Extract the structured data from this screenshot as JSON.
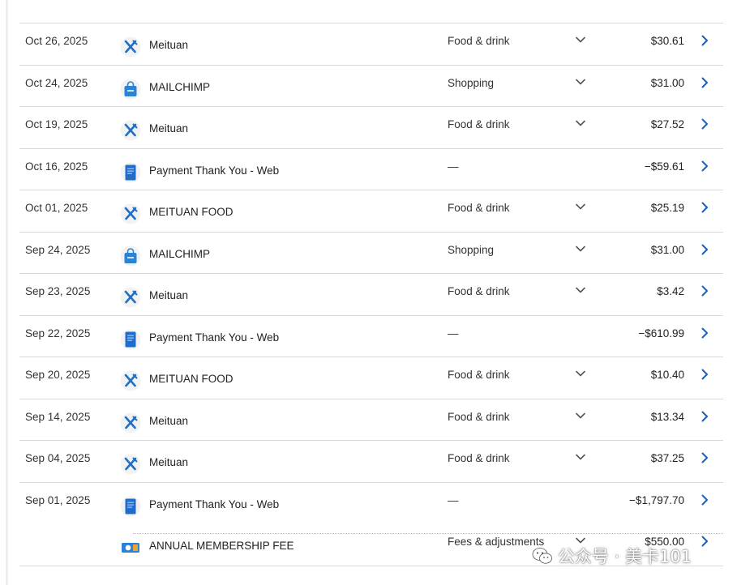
{
  "transactions": [
    {
      "date": "Oct 26, 2025",
      "merchant": "Meituan",
      "icon": "food-icon",
      "category": "Food & drink",
      "amount": "$30.61",
      "expandable": true
    },
    {
      "date": "Oct 24, 2025",
      "merchant": "MAILCHIMP",
      "icon": "shopping-bag-icon",
      "category": "Shopping",
      "amount": "$31.00",
      "expandable": true
    },
    {
      "date": "Oct 19, 2025",
      "merchant": "Meituan",
      "icon": "food-icon",
      "category": "Food & drink",
      "amount": "$27.52",
      "expandable": true
    },
    {
      "date": "Oct 16, 2025",
      "merchant": "Payment Thank You - Web",
      "icon": "payment-icon",
      "category": "—",
      "amount": "−$59.61",
      "expandable": false
    },
    {
      "date": "Oct 01, 2025",
      "merchant": "MEITUAN FOOD",
      "icon": "food-icon",
      "category": "Food & drink",
      "amount": "$25.19",
      "expandable": true
    },
    {
      "date": "Sep 24, 2025",
      "merchant": "MAILCHIMP",
      "icon": "shopping-bag-icon",
      "category": "Shopping",
      "amount": "$31.00",
      "expandable": true
    },
    {
      "date": "Sep 23, 2025",
      "merchant": "Meituan",
      "icon": "food-icon",
      "category": "Food & drink",
      "amount": "$3.42",
      "expandable": true
    },
    {
      "date": "Sep 22, 2025",
      "merchant": "Payment Thank You - Web",
      "icon": "payment-icon",
      "category": "—",
      "amount": "−$610.99",
      "expandable": false
    },
    {
      "date": "Sep 20, 2025",
      "merchant": "MEITUAN FOOD",
      "icon": "food-icon",
      "category": "Food & drink",
      "amount": "$10.40",
      "expandable": true
    },
    {
      "date": "Sep 14, 2025",
      "merchant": "Meituan",
      "icon": "food-icon",
      "category": "Food & drink",
      "amount": "$13.34",
      "expandable": true
    },
    {
      "date": "Sep 04, 2025",
      "merchant": "Meituan",
      "icon": "food-icon",
      "category": "Food & drink",
      "amount": "$37.25",
      "expandable": true
    },
    {
      "date": "Sep 01, 2025",
      "merchant": "Payment Thank You - Web",
      "icon": "payment-icon",
      "category": "—",
      "amount": "−$1,797.70",
      "expandable": false
    },
    {
      "date": "",
      "merchant": "ANNUAL MEMBERSHIP FEE",
      "icon": "fee-icon",
      "category": "Fees & adjustments",
      "amount": "$550.00",
      "expandable": true
    }
  ],
  "watermark": {
    "text": "公众号 · 美卡101",
    "icon": "wechat-icon"
  },
  "colors": {
    "accent": "#1c5fb8",
    "divider": "#d9d9d9",
    "food_icon_blue": "#1f6fc6",
    "bag_blue": "#2b83d6"
  }
}
